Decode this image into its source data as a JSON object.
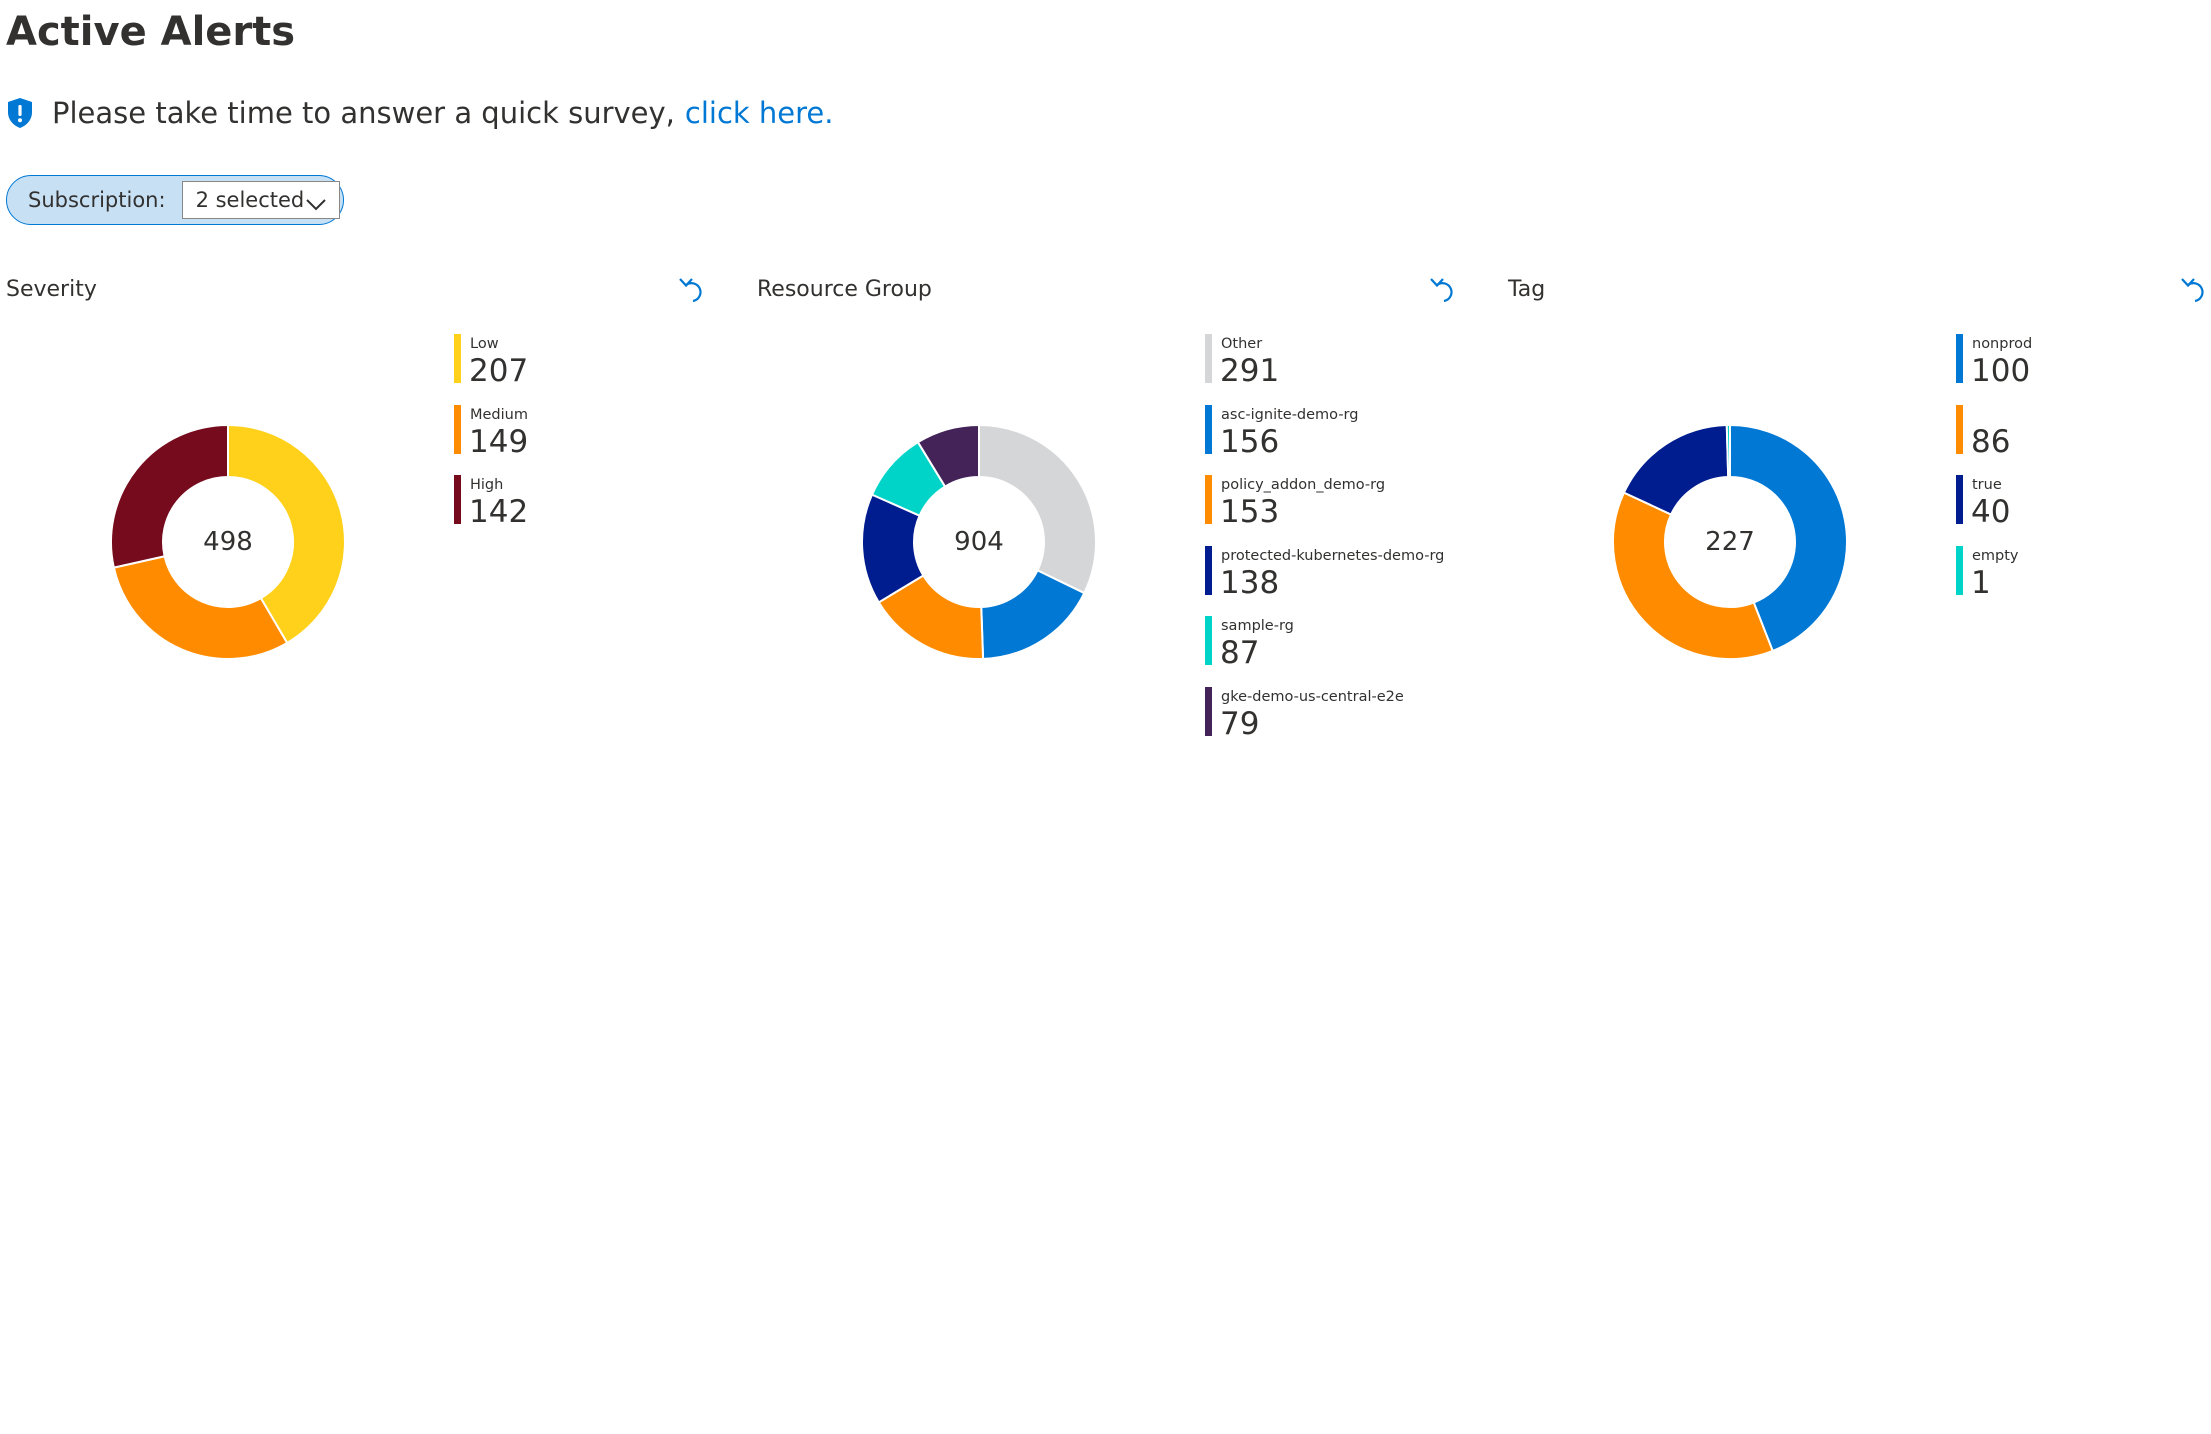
{
  "page": {
    "title": "Active Alerts"
  },
  "survey": {
    "icon": "shield-info-icon",
    "text": "Please take time to answer a quick survey,",
    "link_text": "click here."
  },
  "filter": {
    "label": "Subscription:",
    "value": "2 selected",
    "icon": "chevron-down-icon"
  },
  "colors": {
    "accent": "#0078d4",
    "pill_background": "#c7e0f4"
  },
  "panels": [
    {
      "title": "Severity",
      "total": "498",
      "reset_icon": "undo-icon",
      "items": [
        {
          "label": "Low",
          "value": "207",
          "color": "#ffd11a"
        },
        {
          "label": "Medium",
          "value": "149",
          "color": "#ff8c00"
        },
        {
          "label": "High",
          "value": "142",
          "color": "#750b1c"
        }
      ]
    },
    {
      "title": "Resource Group",
      "total": "904",
      "reset_icon": "undo-icon",
      "items": [
        {
          "label": "Other",
          "value": "291",
          "color": "#d5d6d8"
        },
        {
          "label": "asc-ignite-demo-rg",
          "value": "156",
          "color": "#0078d4"
        },
        {
          "label": "policy_addon_demo-rg",
          "value": "153",
          "color": "#ff8c00"
        },
        {
          "label": "protected-kubernetes-demo-rg",
          "value": "138",
          "color": "#001d8f"
        },
        {
          "label": "sample-rg",
          "value": "87",
          "color": "#00d4c8"
        },
        {
          "label": "gke-demo-us-central-e2e",
          "value": "79",
          "color": "#442359"
        }
      ]
    },
    {
      "title": "Tag",
      "total": "227",
      "reset_icon": "undo-icon",
      "items": [
        {
          "label": "nonprod",
          "value": "100",
          "color": "#0078d4"
        },
        {
          "label": "",
          "value": "86",
          "color": "#ff8c00"
        },
        {
          "label": "true",
          "value": "40",
          "color": "#001d8f"
        },
        {
          "label": "empty",
          "value": "1",
          "color": "#00d4c8"
        }
      ]
    }
  ],
  "chart_data": [
    {
      "type": "donut",
      "title": "Severity",
      "total": 498,
      "categories": [
        "Low",
        "Medium",
        "High"
      ],
      "values": [
        207,
        149,
        142
      ],
      "colors": [
        "#ffd11a",
        "#ff8c00",
        "#750b1c"
      ],
      "legend": "right"
    },
    {
      "type": "donut",
      "title": "Resource Group",
      "total": 904,
      "categories": [
        "Other",
        "asc-ignite-demo-rg",
        "policy_addon_demo-rg",
        "protected-kubernetes-demo-rg",
        "sample-rg",
        "gke-demo-us-central-e2e"
      ],
      "values": [
        291,
        156,
        153,
        138,
        87,
        79
      ],
      "colors": [
        "#d5d6d8",
        "#0078d4",
        "#ff8c00",
        "#001d8f",
        "#00d4c8",
        "#442359"
      ],
      "legend": "right"
    },
    {
      "type": "donut",
      "title": "Tag",
      "total": 227,
      "categories": [
        "nonprod",
        "",
        "true",
        "empty"
      ],
      "values": [
        100,
        86,
        40,
        1
      ],
      "colors": [
        "#0078d4",
        "#ff8c00",
        "#001d8f",
        "#00d4c8"
      ],
      "legend": "right"
    }
  ]
}
